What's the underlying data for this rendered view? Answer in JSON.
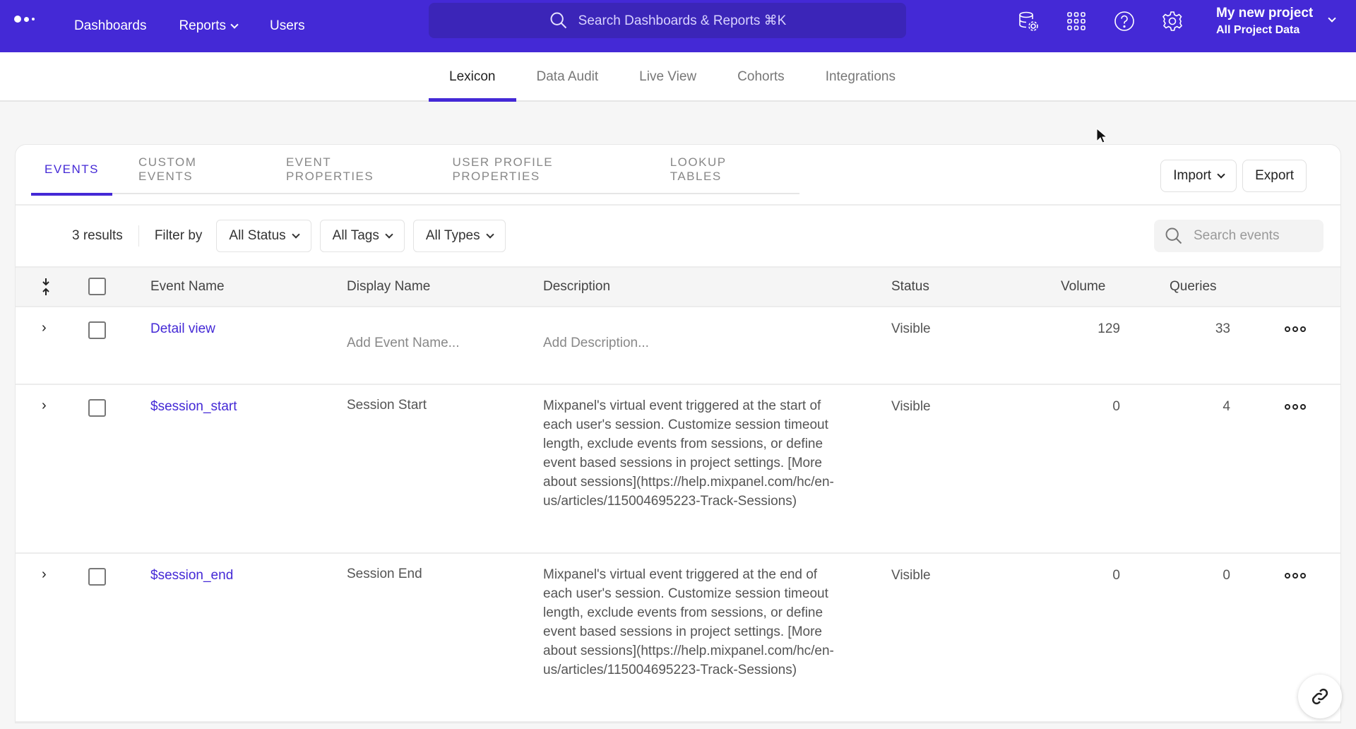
{
  "topbar": {
    "nav": [
      {
        "label": "Dashboards"
      },
      {
        "label": "Reports",
        "has_dropdown": true
      },
      {
        "label": "Users"
      }
    ],
    "search_placeholder": "Search Dashboards & Reports ⌘K",
    "icons": [
      "data-settings-icon",
      "apps-grid-icon",
      "help-icon",
      "settings-gear-icon"
    ],
    "project": {
      "name": "My new project",
      "scope": "All Project Data"
    }
  },
  "subnav": {
    "tabs": [
      {
        "label": "Lexicon",
        "active": true
      },
      {
        "label": "Data Audit"
      },
      {
        "label": "Live View"
      },
      {
        "label": "Cohorts"
      },
      {
        "label": "Integrations"
      }
    ]
  },
  "lexicon": {
    "tabs": [
      {
        "label": "EVENTS",
        "active": true
      },
      {
        "label": "CUSTOM EVENTS"
      },
      {
        "label": "EVENT PROPERTIES"
      },
      {
        "label": "USER PROFILE PROPERTIES"
      },
      {
        "label": "LOOKUP TABLES"
      }
    ],
    "import_label": "Import",
    "export_label": "Export",
    "results": "3 results",
    "filter_by": "Filter by",
    "filters": [
      "All Status",
      "All Tags",
      "All Types"
    ],
    "search_placeholder": "Search events",
    "columns": {
      "event_name": "Event Name",
      "display_name": "Display Name",
      "description": "Description",
      "status": "Status",
      "volume": "Volume",
      "queries": "Queries"
    },
    "rows": [
      {
        "event_name": "Detail view",
        "display_name": "Add Event Name...",
        "display_placeholder": true,
        "description": "Add Description...",
        "description_placeholder": true,
        "status": "Visible",
        "volume": "129",
        "queries": "33"
      },
      {
        "event_name": "$session_start",
        "display_name": "Session Start",
        "description": "Mixpanel's virtual event triggered at the start of each user's session. Customize session timeout length, exclude events from sessions, or define event based sessions in project settings. [More about sessions](https://help.mixpanel.com/hc/en-us/articles/115004695223-Track-Sessions)",
        "status": "Visible",
        "volume": "0",
        "queries": "4"
      },
      {
        "event_name": "$session_end",
        "display_name": "Session End",
        "description": "Mixpanel's virtual event triggered at the end of each user's session. Customize session timeout length, exclude events from sessions, or define event based sessions in project settings. [More about sessions](https://help.mixpanel.com/hc/en-us/articles/115004695223-Track-Sessions)",
        "status": "Visible",
        "volume": "0",
        "queries": "0"
      }
    ]
  },
  "colors": {
    "brand": "#4429d6",
    "search_bg": "#3b25b8"
  }
}
